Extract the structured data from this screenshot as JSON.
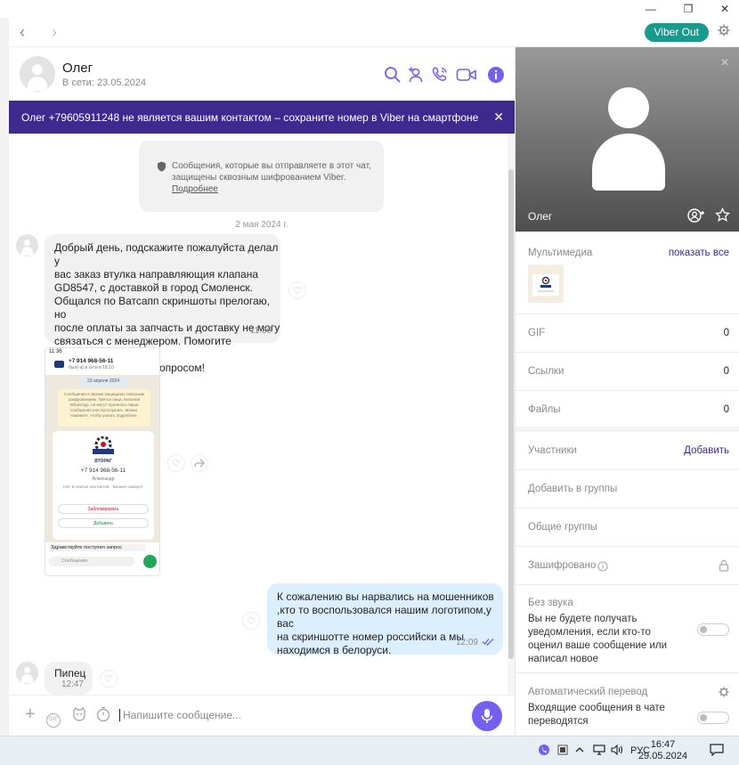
{
  "window": {
    "minimize_glyph": "—",
    "restore_glyph": "❐",
    "close_glyph": "✕"
  },
  "nav": {
    "back_glyph": "‹",
    "forward_glyph": "›",
    "viber_out_label": "Viber Out"
  },
  "header": {
    "contact_name": "Олег",
    "status": "В сети: 23.05.2024"
  },
  "banner": {
    "text": "Олег +79605911248 не является вашим контактом – сохраните номер в Viber на смартфоне",
    "close_glyph": "✕"
  },
  "chat": {
    "e2e_text": "Сообщения, которые вы отправляете в этот чат, защищены сквозным шифрованием Viber.",
    "e2e_link": "Подробнее",
    "date_separator": "2 мая 2024 г.",
    "messages": [
      {
        "text": "Добрый день, подскажите пожалуйста делал у\nвас заказ втулка направляющия клапана\nGD8547, с доставкой в город Смоленск.\nОбщался по Ватсапп скриншоты прелогаю,  но\nпосле оплаты за запчасть и доставку не могу\nсвязаться с менеджером. Помогите пожалуйста\nразобраться с этим вопросом!",
        "time": "11:36"
      },
      {
        "text": "К сожалению вы нарвались на мошенников\n,кто то воспользовался нашим логотипом,у вас\nна скриншотте номер российски а мы\nнаходимся в белоруси.",
        "time": "12:09"
      },
      {
        "text": "Пипец",
        "time": "12:47"
      }
    ],
    "screenshot": {
      "time": "11:36",
      "phone": "+7 914 968-56-11",
      "last_seen": "был(-а) в сети в 18:10",
      "date": "23 апреля 2024",
      "notice": "Сообщения и звонки защищены сквозным шифрованием. Третьи лица, включая WhatsApp, не могут прочитать ваши сообщения или прослушать звонки. Нажмите, чтобы узнать подробнее.",
      "logo_text": "ВТОРАГ",
      "card_phone": "+7 914 968-56-11",
      "card_name": "Александр",
      "card_status": "Нет в списке контактов · Бизнес-аккаунт",
      "block_label": "Заблокировать",
      "add_label": "Добавить",
      "draft": "Здравствуйте поступил запрос",
      "input_placeholder": "Сообщение"
    }
  },
  "composer": {
    "placeholder": "Напишите сообщение...",
    "plus_glyph": "+",
    "gif_label": "GIF"
  },
  "panel": {
    "profile_name": "Олег",
    "multimedia_label": "Мультимедиа",
    "show_all": "показать все",
    "gif_label": "GIF",
    "gif_count": "0",
    "links_label": "Ссылки",
    "links_count": "0",
    "files_label": "Файлы",
    "files_count": "0",
    "participants_label": "Участники",
    "add_label": "Добавить",
    "add_to_groups": "Добавить в группы",
    "common_groups": "Общие группы",
    "encrypted_label": "Зашифровано",
    "mute_label": "Без звука",
    "mute_desc": "Вы не будете получать уведомления, если кто-то оценил ваше сообщение или написал новое",
    "auto_translate_label": "Автоматический перевод",
    "auto_translate_desc": "Входящие сообщения в чате переводятся"
  },
  "taskbar": {
    "lang": "РУС",
    "time": "16:47",
    "date": "29.05.2024"
  },
  "colors": {
    "viber_purple": "#7360f2",
    "banner_bg": "#3e2a8f",
    "viber_out_bg": "#1a9a8c",
    "outgoing_bubble": "#dcefff"
  }
}
